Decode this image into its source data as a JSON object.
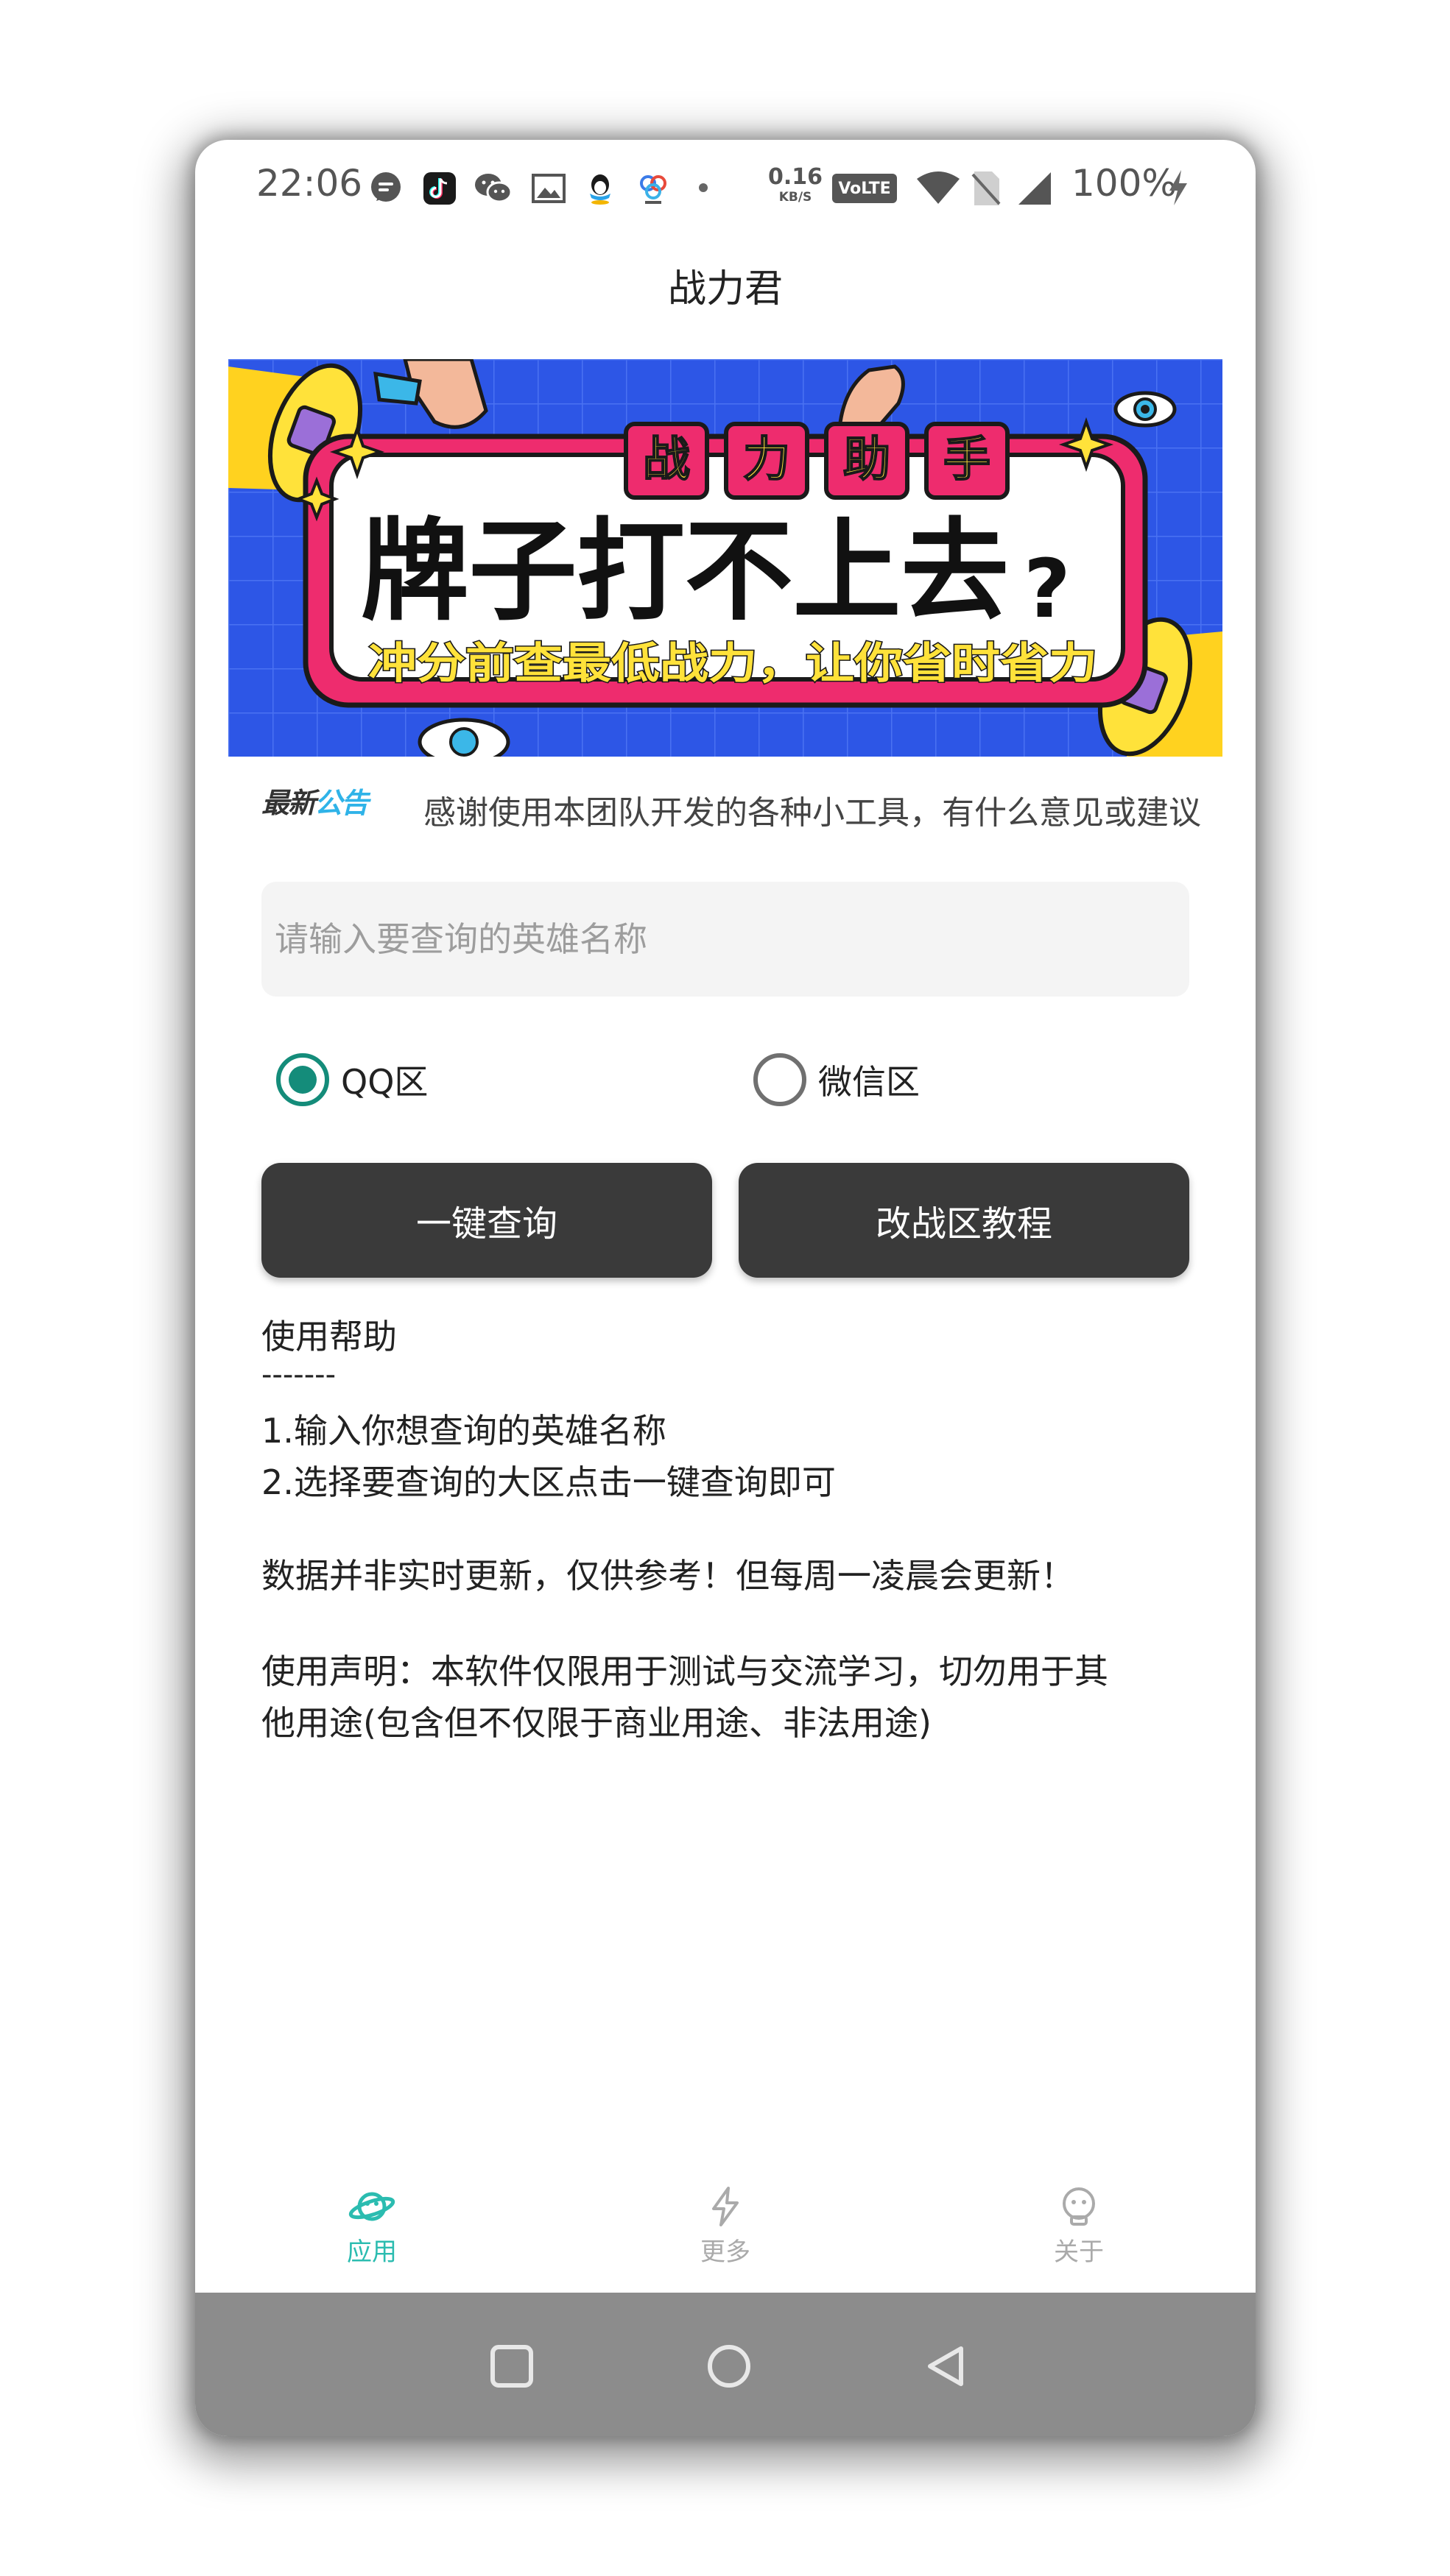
{
  "status_bar": {
    "time": "22:06",
    "speed_value": "0.16",
    "speed_unit": "KB/S",
    "volte": "VoLTE",
    "battery": "100%"
  },
  "app": {
    "title": "战力君"
  },
  "banner": {
    "tag_chars": [
      "战",
      "力",
      "助",
      "手"
    ],
    "headline": "牌子打不上去",
    "question_mark": "?",
    "subline": "冲分前查最低战力，让你省时省力"
  },
  "notice": {
    "logo_part1": "最新",
    "logo_part2": "公告",
    "text": "感谢使用本团队开发的各种小工具，有什么意见或建议"
  },
  "search": {
    "placeholder": "请输入要查询的英雄名称",
    "value": ""
  },
  "region": {
    "options": [
      {
        "label": "QQ区",
        "checked": true
      },
      {
        "label": "微信区",
        "checked": false
      }
    ]
  },
  "buttons": {
    "query": "一键查询",
    "tutorial": "改战区教程"
  },
  "help": {
    "title": "使用帮助",
    "divider": "-------",
    "step1": "1.输入你想查询的英雄名称",
    "step2": "2.选择要查询的大区点击一键查询即可",
    "update_note": "数据并非实时更新，仅供参考！但每周一凌晨会更新！",
    "disclaimer_line1": "使用声明：本软件仅限用于测试与交流学习，切勿用于其",
    "disclaimer_line2": "他用途(包含但不仅限于商业用途、非法用途)"
  },
  "tabs": [
    {
      "label": "应用",
      "icon": "planet-icon",
      "active": true
    },
    {
      "label": "更多",
      "icon": "lightning-icon",
      "active": false
    },
    {
      "label": "关于",
      "icon": "robot-icon",
      "active": false
    }
  ],
  "colors": {
    "accent": "#148c7a",
    "tab_active": "#2bbcb0",
    "button_bg": "#3a3a3a",
    "banner_blue": "#2d56e6",
    "banner_pink": "#ee2c6e",
    "banner_yellow": "#ffe23a"
  }
}
